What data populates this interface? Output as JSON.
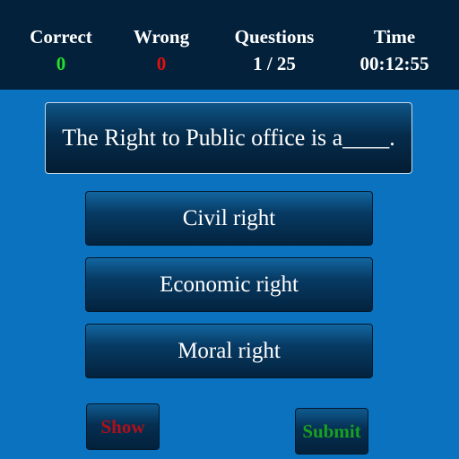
{
  "stats": {
    "correct": {
      "label": "Correct",
      "value": "0"
    },
    "wrong": {
      "label": "Wrong",
      "value": "0"
    },
    "questions": {
      "label": "Questions",
      "value": "1 / 25"
    },
    "time": {
      "label": "Time",
      "value": "00:12:55"
    }
  },
  "question": {
    "text": "The Right to Public office is a____."
  },
  "options": [
    {
      "label": "Civil right"
    },
    {
      "label": "Economic right"
    },
    {
      "label": "Moral right"
    }
  ],
  "actions": {
    "show_label": "Show",
    "submit_label": "Submit"
  },
  "colors": {
    "background": "#0b72bf",
    "header": "#03213b",
    "correct_value": "#22e02a",
    "wrong_value": "#e01010",
    "show_text": "#b0101a",
    "submit_text": "#1aa020"
  }
}
